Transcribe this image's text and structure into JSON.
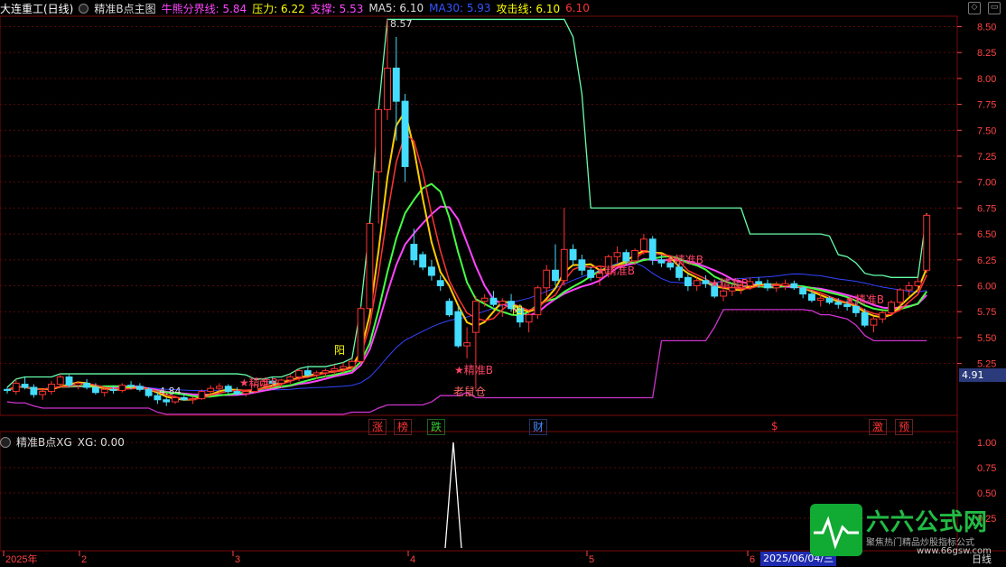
{
  "header": {
    "title": "大连重工(日线)",
    "indicator_name": "精准B点主图",
    "items": [
      {
        "label": "牛熊分界线: 5.84",
        "color": "#ff44ff"
      },
      {
        "label": "压力: 6.22",
        "color": "#ffff00"
      },
      {
        "label": "支撑: 5.53",
        "color": "#ff44ff"
      },
      {
        "label": "MA5: 6.10",
        "color": "#cccccc"
      },
      {
        "label": "MA30: 5.93",
        "color": "#3344ff"
      },
      {
        "label": "攻击线: 6.10",
        "color": "#ffff00"
      },
      {
        "label": "6.10",
        "color": "#ff3333"
      }
    ]
  },
  "price_axis": [
    "8.50",
    "8.25",
    "8.00",
    "7.75",
    "7.50",
    "7.25",
    "7.00",
    "6.75",
    "6.50",
    "6.25",
    "6.00",
    "5.75",
    "5.50",
    "5.25"
  ],
  "current_price_tag": "4.91",
  "annotations": {
    "peak": "8.57",
    "low": "4.84",
    "yang_1": "阳",
    "yang_2": "阳",
    "b_labels": [
      "精准B",
      "精准B",
      "精准B",
      "精准B",
      "精准B",
      "精准B"
    ],
    "laoshucang": "老鼠仓"
  },
  "event_badges": [
    {
      "text": "涨",
      "color": "#ff3333"
    },
    {
      "text": "榜",
      "color": "#ff3333"
    },
    {
      "text": "跌",
      "color": "#33cc33"
    },
    {
      "text": "财",
      "color": "#4488ff"
    },
    {
      "text": "$",
      "color": "#ff3333"
    },
    {
      "text": "激",
      "color": "#ff3333"
    },
    {
      "text": "预",
      "color": "#ff3333"
    }
  ],
  "sub_panel": {
    "title": "精准B点XG",
    "value_label": "XG: 0.00",
    "axis": [
      "1.00",
      "0.75",
      "0.50",
      "0.25"
    ]
  },
  "time_axis": {
    "labels": [
      "2025年",
      "2",
      "3",
      "4",
      "5",
      "6"
    ],
    "cursor_date": "2025/06/04/三",
    "period": "日线"
  },
  "watermark": {
    "brand": "六六公式网",
    "slogan": "聚焦热门精品炒股指标公式",
    "url": "www.66gsw.com"
  },
  "chart_data": {
    "type": "candlestick",
    "ylim": [
      4.75,
      8.6
    ],
    "candles": [
      [
        5.0,
        5.02,
        4.96,
        4.99
      ],
      [
        4.98,
        5.1,
        4.95,
        5.06
      ],
      [
        5.05,
        5.12,
        5.0,
        5.02
      ],
      [
        5.02,
        5.05,
        4.92,
        4.95
      ],
      [
        4.95,
        5.0,
        4.9,
        4.98
      ],
      [
        4.98,
        5.08,
        4.95,
        5.05
      ],
      [
        5.05,
        5.15,
        5.03,
        5.12
      ],
      [
        5.12,
        5.14,
        5.02,
        5.04
      ],
      [
        5.04,
        5.08,
        5.0,
        5.06
      ],
      [
        5.06,
        5.1,
        5.0,
        5.02
      ],
      [
        5.02,
        5.06,
        4.95,
        4.97
      ],
      [
        4.97,
        5.02,
        4.93,
        5.0
      ],
      [
        5.0,
        5.04,
        4.96,
        4.99
      ],
      [
        4.99,
        5.06,
        4.97,
        5.04
      ],
      [
        5.04,
        5.08,
        5.0,
        5.03
      ],
      [
        5.03,
        5.06,
        4.98,
        5.0
      ],
      [
        5.0,
        5.02,
        4.92,
        4.94
      ],
      [
        4.94,
        4.98,
        4.86,
        4.9
      ],
      [
        4.9,
        4.92,
        4.84,
        4.88
      ],
      [
        4.88,
        4.94,
        4.86,
        4.92
      ],
      [
        4.92,
        4.96,
        4.89,
        4.9
      ],
      [
        4.9,
        4.93,
        4.86,
        4.91
      ],
      [
        4.91,
        5.0,
        4.9,
        4.98
      ],
      [
        4.98,
        5.04,
        4.96,
        5.01
      ],
      [
        5.01,
        5.06,
        4.98,
        5.03
      ],
      [
        5.03,
        5.05,
        4.96,
        4.98
      ],
      [
        4.98,
        5.02,
        4.94,
        4.96
      ],
      [
        4.96,
        5.0,
        4.93,
        4.98
      ],
      [
        4.98,
        5.06,
        4.96,
        5.04
      ],
      [
        5.04,
        5.1,
        5.02,
        5.08
      ],
      [
        5.08,
        5.12,
        5.04,
        5.06
      ],
      [
        5.06,
        5.1,
        5.02,
        5.09
      ],
      [
        5.09,
        5.15,
        5.05,
        5.12
      ],
      [
        5.12,
        5.2,
        5.08,
        5.18
      ],
      [
        5.18,
        5.22,
        5.12,
        5.14
      ],
      [
        5.14,
        5.18,
        5.1,
        5.16
      ],
      [
        5.16,
        5.2,
        5.12,
        5.18
      ],
      [
        5.18,
        5.24,
        5.14,
        5.2
      ],
      [
        5.2,
        5.26,
        5.16,
        5.22
      ],
      [
        5.22,
        5.3,
        5.18,
        5.27
      ],
      [
        5.27,
        5.8,
        5.25,
        5.78
      ],
      [
        5.78,
        6.6,
        5.78,
        6.6
      ],
      [
        7.1,
        7.7,
        6.6,
        7.7
      ],
      [
        7.7,
        8.57,
        7.6,
        8.1
      ],
      [
        8.1,
        8.4,
        7.4,
        7.78
      ],
      [
        7.78,
        7.85,
        7.0,
        7.15
      ],
      [
        6.4,
        6.55,
        6.2,
        6.25
      ],
      [
        6.3,
        6.33,
        6.15,
        6.18
      ],
      [
        6.18,
        6.25,
        6.05,
        6.1
      ],
      [
        6.05,
        6.1,
        5.95,
        6.0
      ],
      [
        5.85,
        5.88,
        5.7,
        5.72
      ],
      [
        5.75,
        5.8,
        5.4,
        5.42
      ],
      [
        5.42,
        5.6,
        5.3,
        5.45
      ],
      [
        5.55,
        5.9,
        5.0,
        5.85
      ],
      [
        5.85,
        5.92,
        5.8,
        5.88
      ],
      [
        5.88,
        5.95,
        5.8,
        5.82
      ],
      [
        5.82,
        5.88,
        5.7,
        5.85
      ],
      [
        5.85,
        5.92,
        5.75,
        5.78
      ],
      [
        5.78,
        5.82,
        5.6,
        5.65
      ],
      [
        5.65,
        5.75,
        5.55,
        5.72
      ],
      [
        5.72,
        6.0,
        5.68,
        5.98
      ],
      [
        5.98,
        6.2,
        5.9,
        6.15
      ],
      [
        6.15,
        6.4,
        6.0,
        6.05
      ],
      [
        6.05,
        6.75,
        6.0,
        6.35
      ],
      [
        6.35,
        6.4,
        6.2,
        6.25
      ],
      [
        6.25,
        6.3,
        6.1,
        6.15
      ],
      [
        6.15,
        6.18,
        6.05,
        6.08
      ],
      [
        6.08,
        6.15,
        6.0,
        6.12
      ],
      [
        6.12,
        6.3,
        6.08,
        6.28
      ],
      [
        6.28,
        6.38,
        6.22,
        6.32
      ],
      [
        6.32,
        6.35,
        6.2,
        6.24
      ],
      [
        6.24,
        6.36,
        6.2,
        6.34
      ],
      [
        6.34,
        6.5,
        6.3,
        6.45
      ],
      [
        6.45,
        6.48,
        6.2,
        6.25
      ],
      [
        6.25,
        6.3,
        6.18,
        6.22
      ],
      [
        6.22,
        6.28,
        6.15,
        6.18
      ],
      [
        6.18,
        6.22,
        6.05,
        6.08
      ],
      [
        6.08,
        6.12,
        5.95,
        6.0
      ],
      [
        6.0,
        6.08,
        5.95,
        6.05
      ],
      [
        6.05,
        6.1,
        5.98,
        6.02
      ],
      [
        6.02,
        6.06,
        5.88,
        5.9
      ],
      [
        5.9,
        6.0,
        5.85,
        5.95
      ],
      [
        5.95,
        6.02,
        5.9,
        5.98
      ],
      [
        5.98,
        6.05,
        5.92,
        6.0
      ],
      [
        6.0,
        6.08,
        5.96,
        6.04
      ],
      [
        6.04,
        6.08,
        5.98,
        6.02
      ],
      [
        6.02,
        6.06,
        5.95,
        5.98
      ],
      [
        5.98,
        6.04,
        5.94,
        6.0
      ],
      [
        6.0,
        6.06,
        5.96,
        6.02
      ],
      [
        6.02,
        6.05,
        5.96,
        5.98
      ],
      [
        5.98,
        6.0,
        5.88,
        5.92
      ],
      [
        5.92,
        5.96,
        5.84,
        5.86
      ],
      [
        5.86,
        5.92,
        5.8,
        5.88
      ],
      [
        5.88,
        5.9,
        5.82,
        5.84
      ],
      [
        5.84,
        5.88,
        5.78,
        5.82
      ],
      [
        5.82,
        5.86,
        5.76,
        5.8
      ],
      [
        5.8,
        5.84,
        5.7,
        5.74
      ],
      [
        5.74,
        5.78,
        5.6,
        5.62
      ],
      [
        5.62,
        5.7,
        5.55,
        5.68
      ],
      [
        5.68,
        5.76,
        5.64,
        5.74
      ],
      [
        5.74,
        5.86,
        5.72,
        5.84
      ],
      [
        5.84,
        5.98,
        5.8,
        5.96
      ],
      [
        5.96,
        6.04,
        5.9,
        6.0
      ],
      [
        6.0,
        6.08,
        5.95,
        6.04
      ],
      [
        6.15,
        6.7,
        6.12,
        6.68
      ]
    ],
    "sub_values_peak": 1.0
  }
}
